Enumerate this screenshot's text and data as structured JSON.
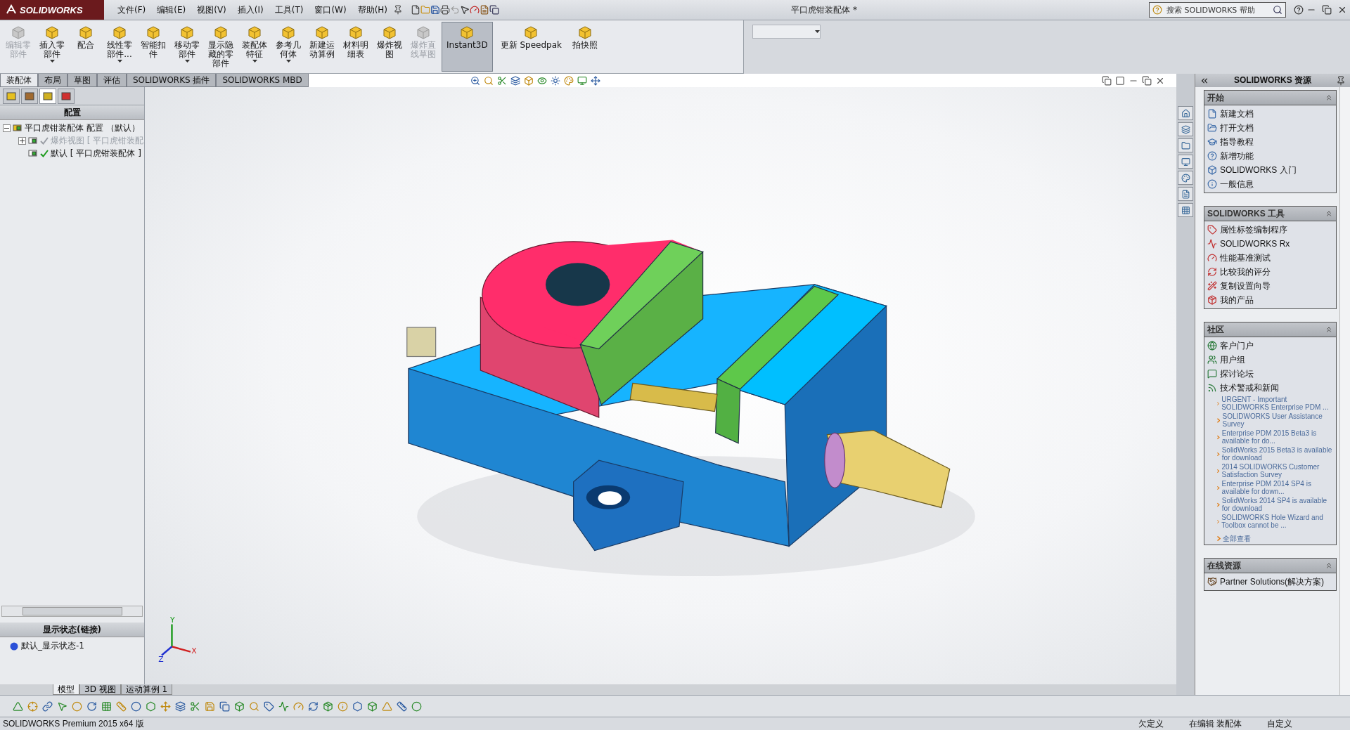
{
  "app": {
    "logo": "SOLIDWORKS",
    "document_title": "平口虎钳装配体 *"
  },
  "menu": [
    "文件(F)",
    "编辑(E)",
    "视图(V)",
    "插入(I)",
    "工具(T)",
    "窗口(W)",
    "帮助(H)"
  ],
  "help_search": {
    "placeholder": "搜索 SOLIDWORKS 帮助"
  },
  "command_manager": [
    {
      "label": "编辑零部件",
      "kind": "narrow",
      "disabled": true,
      "dropdown": false,
      "selected": false
    },
    {
      "label": "插入零部件",
      "kind": "narrow",
      "disabled": false,
      "dropdown": true,
      "selected": false
    },
    {
      "label": "配合",
      "kind": "narrow",
      "disabled": false,
      "dropdown": false,
      "selected": false
    },
    {
      "label": "线性零部件...",
      "kind": "narrow",
      "disabled": false,
      "dropdown": true,
      "selected": false
    },
    {
      "label": "智能扣件",
      "kind": "narrow",
      "disabled": false,
      "dropdown": false,
      "selected": false
    },
    {
      "label": "移动零部件",
      "kind": "narrow",
      "disabled": false,
      "dropdown": true,
      "selected": false
    },
    {
      "label": "显示隐藏的零部件",
      "kind": "narrow",
      "disabled": false,
      "dropdown": false,
      "selected": false
    },
    {
      "label": "装配体特征",
      "kind": "narrow",
      "disabled": false,
      "dropdown": true,
      "selected": false
    },
    {
      "label": "参考几何体",
      "kind": "narrow",
      "disabled": false,
      "dropdown": true,
      "selected": false
    },
    {
      "label": "新建运动算例",
      "kind": "narrow",
      "disabled": false,
      "dropdown": false,
      "selected": false
    },
    {
      "label": "材料明细表",
      "kind": "narrow",
      "disabled": false,
      "dropdown": false,
      "selected": false
    },
    {
      "label": "爆炸视图",
      "kind": "narrow",
      "disabled": false,
      "dropdown": false,
      "selected": false
    },
    {
      "label": "爆炸直线草图",
      "kind": "narrow",
      "disabled": true,
      "dropdown": false,
      "selected": false
    },
    {
      "label": "Instant3D",
      "kind": "wide",
      "disabled": false,
      "dropdown": false,
      "selected": true
    },
    {
      "label": "更新 Speedpak",
      "kind": "wide",
      "disabled": false,
      "dropdown": false,
      "selected": false
    },
    {
      "label": "拍快照",
      "kind": "narrow",
      "disabled": false,
      "dropdown": false,
      "selected": false
    }
  ],
  "tabs": [
    {
      "label": "装配体",
      "selected": true
    },
    {
      "label": "布局",
      "selected": false
    },
    {
      "label": "草图",
      "selected": false
    },
    {
      "label": "评估",
      "selected": false
    },
    {
      "label": "SOLIDWORKS 插件",
      "selected": false
    },
    {
      "label": "SOLIDWORKS MBD",
      "selected": false
    }
  ],
  "left_panel": {
    "tabs": [
      {
        "selected": false
      },
      {
        "selected": false
      },
      {
        "selected": true
      },
      {
        "selected": false
      }
    ],
    "title": "配置",
    "tree": [
      {
        "label": "平口虎钳装配体 配置 （默认）",
        "expanded": true,
        "children": [
          {
            "label": "爆炸视图 [ 平口虎钳装配",
            "expanded": false,
            "active": false
          },
          {
            "label": "默认 [ 平口虎钳装配体 ]",
            "active": true
          }
        ]
      }
    ],
    "display_states": {
      "title": "显示状态(链接)",
      "items": [
        "默认_显示状态-1"
      ]
    }
  },
  "triad": {
    "x": "X",
    "y": "Y",
    "z": "Z"
  },
  "right_pane": {
    "title": "SOLIDWORKS 资源",
    "sections": [
      {
        "title": "开始",
        "items": [
          "新建文档",
          "打开文档",
          "指导教程",
          "新增功能",
          "SOLIDWORKS 入门",
          "一般信息"
        ]
      },
      {
        "title": "SOLIDWORKS 工具",
        "items": [
          "属性标签编制程序",
          "SOLIDWORKS Rx",
          "性能基准测试",
          "比较我的评分",
          "复制设置向导",
          "我的产品"
        ]
      },
      {
        "title": "社区",
        "items": [
          "客户门户",
          "用户组",
          "探讨论坛",
          "技术警戒和新闻"
        ],
        "news": [
          "URGENT - Important SOLIDWORKS Enterprise PDM ...",
          "SOLIDWORKS User Assistance Survey",
          "Enterprise PDM 2015 Beta3 is available for do...",
          "SolidWorks 2015 Beta3 is available for download",
          "2014 SOLIDWORKS Customer Satisfaction Survey",
          "Enterprise PDM 2014 SP4 is available for down...",
          "SolidWorks 2014 SP4 is available for download",
          "SOLIDWORKS Hole Wizard and Toolbox cannot be ..."
        ],
        "view_all": "全部查看"
      },
      {
        "title": "在线资源",
        "items": [
          "Partner Solutions(解决方案)"
        ]
      }
    ]
  },
  "bottom_tabs": [
    {
      "label": "模型",
      "selected": true
    },
    {
      "label": "3D 视图",
      "selected": false
    },
    {
      "label": "运动算例 1",
      "selected": false
    }
  ],
  "status_bar": {
    "product": "SOLIDWORKS Premium 2015 x64 版",
    "fields": [
      "欠定义",
      "在编辑 装配体",
      "自定义"
    ]
  }
}
